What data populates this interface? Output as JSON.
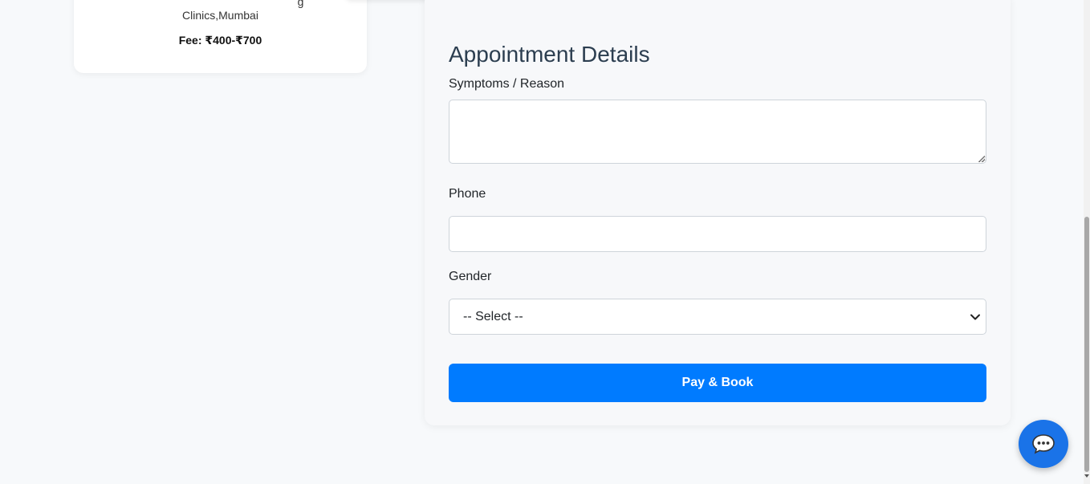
{
  "doctor_card": {
    "clinic_cut": "g",
    "location": "Clinics,Mumbai",
    "fee": "Fee: ₹400-₹700"
  },
  "appointment": {
    "title": "Appointment Details",
    "symptoms_label": "Symptoms / Reason",
    "symptoms_value": "",
    "phone_label": "Phone",
    "phone_value": "",
    "gender_label": "Gender",
    "gender_selected": "-- Select --",
    "pay_button": "Pay & Book"
  },
  "chat": {
    "icon": "speech-bubble-icon"
  },
  "colors": {
    "primary": "#007bff",
    "fab": "#1a73e8",
    "title": "#2c3e50"
  }
}
